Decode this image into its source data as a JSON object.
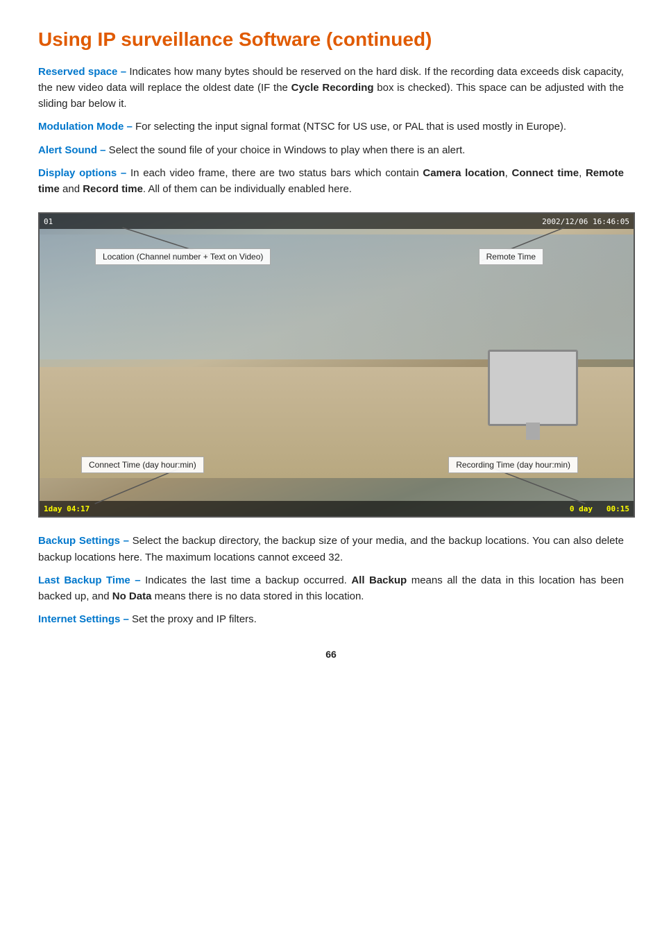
{
  "title": "Using IP surveillance Software (continued)",
  "sections": [
    {
      "term": "Reserved space –",
      "text": " Indicates how many bytes should be reserved on the hard disk. If the recording data exceeds disk capacity, the new video data will replace the oldest date (IF the ",
      "bold1": "Cycle Recording",
      "text2": " box is checked). This space can be adjusted with the sliding bar below it."
    },
    {
      "term": "Modulation Mode –",
      "text": " For selecting the input signal format (NTSC for US use, or PAL that is used mostly in Europe)."
    },
    {
      "term": "Alert Sound –",
      "text": " Select the sound file of your choice in Windows to play when there is an alert."
    },
    {
      "term": "Display options –",
      "text": " In each video frame, there are two status bars which contain ",
      "bold_items": [
        "Camera location",
        "Connect time",
        "Remote time",
        "Record time"
      ],
      "text2": ". All of them can be  individually enabled here."
    }
  ],
  "video": {
    "channel_id": "01",
    "timestamp": "2002/12/06  16:46:05",
    "location_label": "Location (Channel number + Text on Video)",
    "remote_time_label": "Remote Time",
    "connect_time_label": "Connect Time (day hour:min)",
    "recording_time_label": "Recording Time (day hour:min)",
    "connect_time_value": "1day  04:17",
    "record_time_prefix": "0 day",
    "record_time_value": "00:15"
  },
  "sections2": [
    {
      "term": "Backup Settings –",
      "text": " Select the backup directory, the backup size of your  media, and the backup locations. You can also delete backup locations here. The maximum locations cannot exceed 32."
    },
    {
      "term": "Last Backup Time –",
      "text": " Indicates the last time a backup occurred. ",
      "bold1": "All Backup",
      "text2": " means all the data in this location has been backed up, and ",
      "bold2": "No Data",
      "text3": " means there is no data stored in this location."
    },
    {
      "term": "Internet Settings –",
      "text": " Set the proxy and IP filters."
    }
  ],
  "page_number": "66"
}
